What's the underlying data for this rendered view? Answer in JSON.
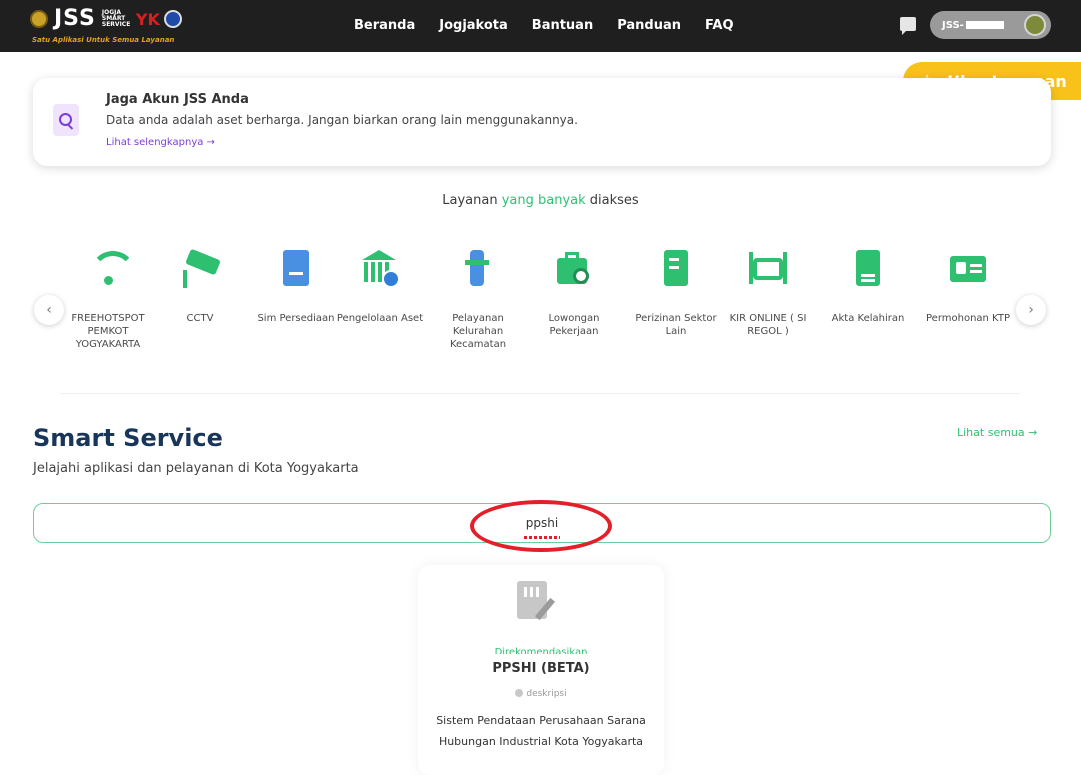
{
  "nav": {
    "logo_text": "JSS",
    "logo_small": "JOGJA SMART SERVICE",
    "logo_yk": "YK",
    "tagline": "Satu Aplikasi Untuk Semua Layanan",
    "links": [
      "Beranda",
      "Jogjakota",
      "Bantuan",
      "Panduan",
      "FAQ"
    ],
    "user_name": "JSS-"
  },
  "review_button": {
    "icon": "star-outline-icon",
    "label": "Ulas Layanan"
  },
  "notice": {
    "icon": "search-icon",
    "title": "Jaga Akun JSS Anda",
    "text": "Data anda adalah aset berharga. Jangan biarkan orang lain menggunakannya.",
    "link": "Lihat selengkapnya  →"
  },
  "popular": {
    "title_pre": "Layanan ",
    "title_hl": "yang banyak",
    "title_post": " diakses",
    "prev": "‹",
    "next": "›",
    "items": [
      {
        "label": "FREEHOTSPOT PEMKOT YOGYAKARTA",
        "icon": "wifi-icon"
      },
      {
        "label": "CCTV",
        "icon": "cctv-icon"
      },
      {
        "label": "Sim Persediaan",
        "icon": "inventory-icon"
      },
      {
        "label": "Pengelolaan Aset",
        "icon": "bank-icon"
      },
      {
        "label": "Pelayanan Kelurahan Kecamatan",
        "icon": "person-service-icon"
      },
      {
        "label": "Lowongan Pekerjaan",
        "icon": "briefcase-search-icon"
      },
      {
        "label": "Perizinan Sektor Lain",
        "icon": "certificate-icon"
      },
      {
        "label": "KIR ONLINE ( SI REGOL )",
        "icon": "car-inspection-icon"
      },
      {
        "label": "Akta Kelahiran",
        "icon": "baby-document-icon"
      },
      {
        "label": "Permohonan KTP",
        "icon": "id-card-icon"
      }
    ]
  },
  "smart_service": {
    "title": "Smart Service",
    "subtitle": "Jelajahi aplikasi dan pelayanan di Kota Yogyakarta",
    "see_all": "Lihat semua  →",
    "search_value": "ppshi"
  },
  "result": {
    "icon": "building-edit-icon",
    "ghost": "Direkomendasikan",
    "title": "PPSHI (BETA)",
    "desc_label": "deskripsi",
    "description": "Sistem Pendataan Perusahaan Sarana Hubungan Industrial Kota Yogyakarta"
  },
  "colors": {
    "accent": "#2fbf71",
    "review": "#f8c21b",
    "navbar": "#1f1f1f",
    "title": "#18355a",
    "highlight_ring": "#e3202a"
  }
}
